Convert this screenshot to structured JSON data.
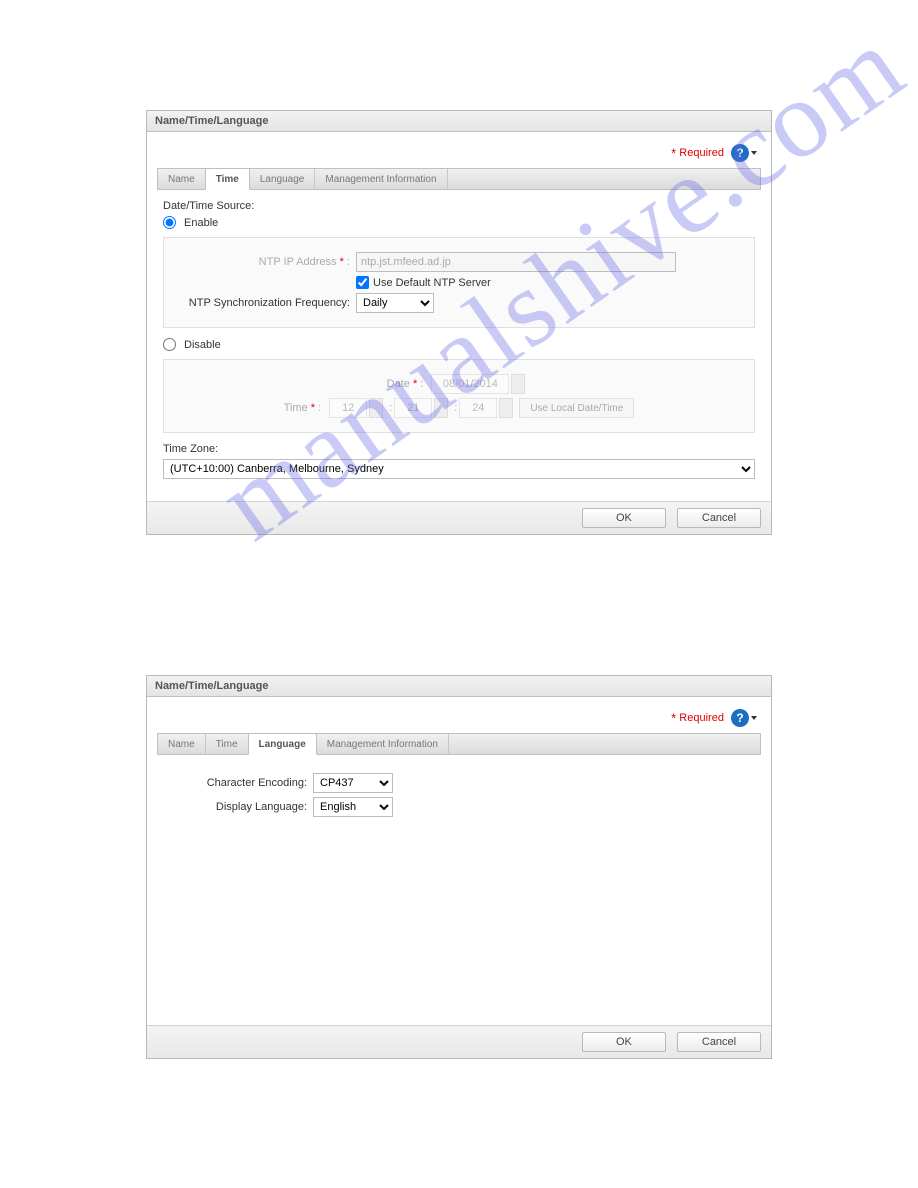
{
  "panel_title": "Name/Time/Language",
  "required_label": "Required",
  "tabs": {
    "name": "Name",
    "time": "Time",
    "language": "Language",
    "mgmt": "Management Information"
  },
  "time": {
    "source_label": "Date/Time Source:",
    "enable": "Enable",
    "disable": "Disable",
    "ntp_ip_label": "NTP IP Address",
    "ntp_ip_value": "ntp.jst.mfeed.ad.jp",
    "use_default_ntp": "Use Default NTP Server",
    "sync_freq_label": "NTP Synchronization Frequency:",
    "sync_freq_value": "Daily",
    "date_label": "Date",
    "date_value": "08/01/2014",
    "time_label": "Time",
    "hh": "12",
    "mm": "21",
    "ss": "24",
    "use_local": "Use Local Date/Time",
    "tz_label": "Time Zone:",
    "tz_value": "(UTC+10:00) Canberra, Melbourne, Sydney"
  },
  "lang": {
    "char_enc_label": "Character Encoding:",
    "char_enc_value": "CP437",
    "disp_lang_label": "Display Language:",
    "disp_lang_value": "English"
  },
  "buttons": {
    "ok": "OK",
    "cancel": "Cancel"
  },
  "watermark": "manualshive.com"
}
